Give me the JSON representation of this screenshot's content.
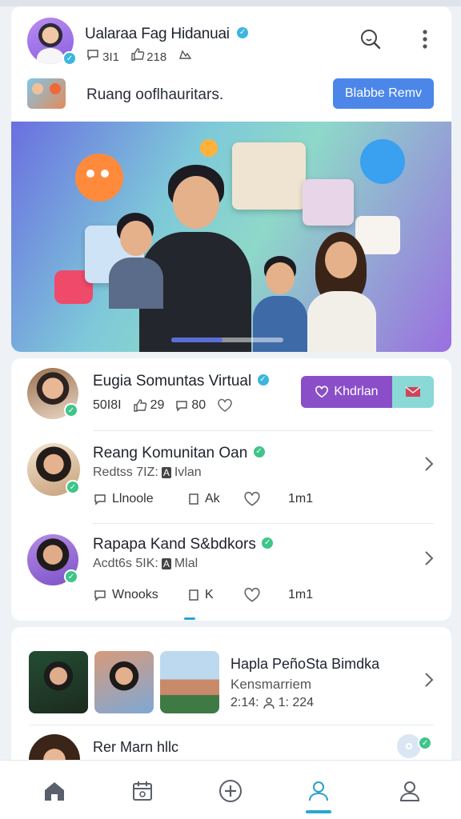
{
  "header": {
    "title": "Ualaraa Fag Hidanuai",
    "stats": [
      {
        "icon": "comment-icon",
        "value": "3I1"
      },
      {
        "icon": "like-icon",
        "value": "218"
      },
      {
        "icon": "share-icon",
        "value": ""
      }
    ]
  },
  "community_row": {
    "label": "Ruang ooflhauritars.",
    "button": "Blabbe Remv"
  },
  "groups": [
    {
      "name": "Eugia Somuntas Virtual",
      "stats": [
        "50I8I",
        "29",
        "80",
        ""
      ],
      "join_label": "Khdrlan"
    },
    {
      "name": "Reang Komunitan Oan",
      "sub": "Redtss 7IZ: ",
      "sub_tag": "A",
      "sub_tail": "Ivlan",
      "actions": [
        "Llnoole",
        "Ak",
        "",
        "1m1"
      ]
    },
    {
      "name": "Rapapa Kand S&bdkors",
      "sub": "Acdt6s 5IK: ",
      "sub_tag": "A",
      "sub_tail": "Mlal",
      "actions": [
        "Wnooks",
        "K",
        "",
        "1m1"
      ]
    }
  ],
  "featured": {
    "title": "Hapla PeñoSta Bimdka",
    "sub": "Kensmarriem",
    "meta": "2:14: ",
    "meta_tail": "1: 224"
  },
  "next_item": {
    "name": "Rer Marn hllc"
  },
  "colors": {
    "accent_blue": "#4c86e8",
    "accent_purple": "#8a4fc8",
    "accent_teal": "#2aa6d4",
    "verify_blue": "#3bb6e0",
    "verify_green": "#3fc58a"
  },
  "tabbar": [
    "home-icon",
    "calendar-icon",
    "add-icon",
    "profile-icon",
    "account-icon"
  ]
}
